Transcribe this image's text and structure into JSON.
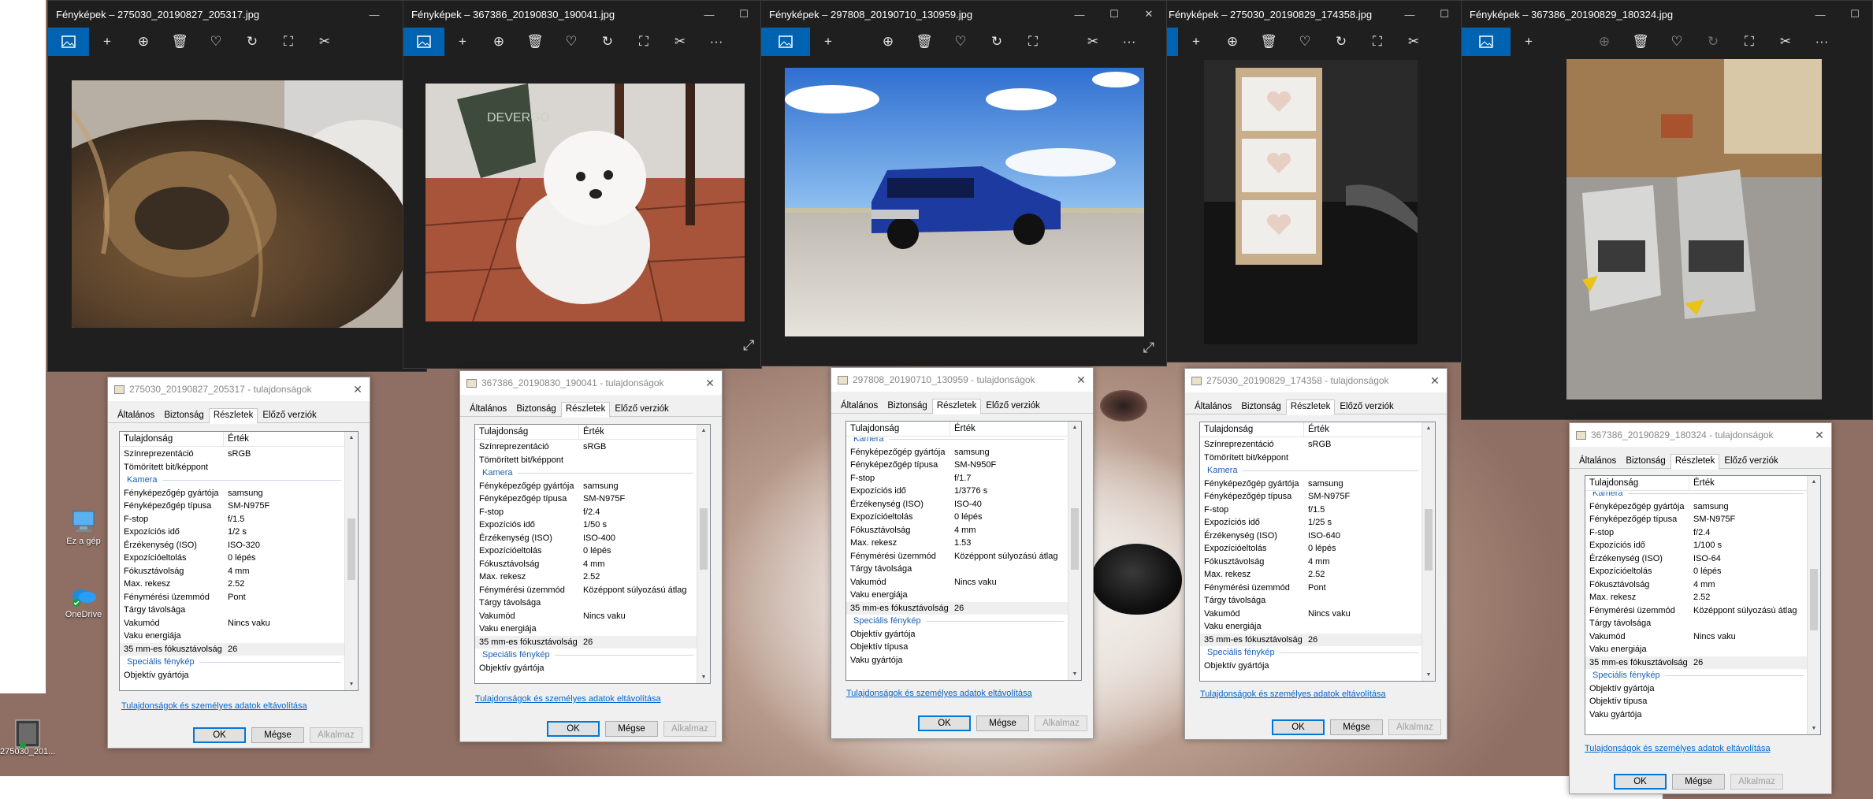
{
  "photos_app": {
    "windows": [
      {
        "title": "Fényképek – 275030_20190827_205317.jpg"
      },
      {
        "title": "Fényképek – 367386_20190830_190041.jpg"
      },
      {
        "title": "Fényképek – 297808_20190710_130959.jpg"
      },
      {
        "title": "Fényképek – 275030_20190829_174358.jpg"
      },
      {
        "title": "Fényképek – 367386_20190829_180324.jpg"
      }
    ],
    "window_controls": {
      "minimize": "—",
      "maximize": "☐",
      "close": "✕"
    },
    "toolbar_glyphs": {
      "add": "+",
      "zoom": "⊕",
      "delete": "🗑",
      "favorite": "♡",
      "rotate": "↻",
      "crop": "⛶",
      "edit": "✂",
      "more": "···",
      "expand": "⤢"
    },
    "bag_text": "DEVERGO"
  },
  "desktop": {
    "icons": [
      {
        "label": "Ez a gép",
        "icon": "computer-icon"
      },
      {
        "label": "OneDrive",
        "icon": "onedrive-icon"
      },
      {
        "label": "275030_201...",
        "icon": "image-file-icon"
      }
    ]
  },
  "dialog_common": {
    "title_suffix": " - tulajdonságok",
    "tabs": [
      "Általános",
      "Biztonság",
      "Részletek",
      "Előző verziók"
    ],
    "column_property": "Tulajdonság",
    "column_value": "Érték",
    "remove_link": "Tulajdonságok és személyes adatok eltávolítása",
    "ok": "OK",
    "cancel": "Mégse",
    "apply": "Alkalmaz",
    "close": "✕"
  },
  "dialogs": [
    {
      "filename": "275030_20190827_205317",
      "rows": [
        {
          "k": "Színreprezentáció",
          "v": "sRGB"
        },
        {
          "k": "Tömörített bit/képpont",
          "v": ""
        },
        {
          "k": "Kamera",
          "v": "",
          "section": true
        },
        {
          "k": "Fényképezőgép gyártója",
          "v": "samsung"
        },
        {
          "k": "Fényképezőgép típusa",
          "v": "SM-N975F"
        },
        {
          "k": "F-stop",
          "v": "f/1.5"
        },
        {
          "k": "Expozíciós idő",
          "v": "1/2 s"
        },
        {
          "k": "Érzékenység (ISO)",
          "v": "ISO-320"
        },
        {
          "k": "Expozícióeltolás",
          "v": "0 lépés"
        },
        {
          "k": "Fókusztávolság",
          "v": "4 mm"
        },
        {
          "k": "Max. rekesz",
          "v": "2.52"
        },
        {
          "k": "Fénymérési üzemmód",
          "v": "Pont"
        },
        {
          "k": "Tárgy távolsága",
          "v": ""
        },
        {
          "k": "Vakumód",
          "v": "Nincs vaku"
        },
        {
          "k": "Vaku energiája",
          "v": ""
        },
        {
          "k": "35 mm-es fókusztávolság",
          "v": "26",
          "selected": true
        },
        {
          "k": "Speciális fénykép",
          "v": "",
          "section": true
        },
        {
          "k": "Objektív gyártója",
          "v": ""
        }
      ]
    },
    {
      "filename": "367386_20190830_190041",
      "rows": [
        {
          "k": "Színreprezentáció",
          "v": "sRGB"
        },
        {
          "k": "Tömörített bit/képpont",
          "v": ""
        },
        {
          "k": "Kamera",
          "v": "",
          "section": true
        },
        {
          "k": "Fényképezőgép gyártója",
          "v": "samsung"
        },
        {
          "k": "Fényképezőgép típusa",
          "v": "SM-N975F"
        },
        {
          "k": "F-stop",
          "v": "f/2.4"
        },
        {
          "k": "Expozíciós idő",
          "v": "1/50 s"
        },
        {
          "k": "Érzékenység (ISO)",
          "v": "ISO-400"
        },
        {
          "k": "Expozícióeltolás",
          "v": "0 lépés"
        },
        {
          "k": "Fókusztávolság",
          "v": "4 mm"
        },
        {
          "k": "Max. rekesz",
          "v": "2.52"
        },
        {
          "k": "Fénymérési üzemmód",
          "v": "Középpont súlyozású átlag"
        },
        {
          "k": "Tárgy távolsága",
          "v": ""
        },
        {
          "k": "Vakumód",
          "v": "Nincs vaku"
        },
        {
          "k": "Vaku energiája",
          "v": ""
        },
        {
          "k": "35 mm-es fókusztávolság",
          "v": "26",
          "selected": true
        },
        {
          "k": "Speciális fénykép",
          "v": "",
          "section": true
        },
        {
          "k": "Objektív gyártója",
          "v": ""
        }
      ]
    },
    {
      "filename": "297808_20190710_130959",
      "rows": [
        {
          "k": "Kamera",
          "v": "",
          "section": true
        },
        {
          "k": "Fényképezőgép gyártója",
          "v": "samsung"
        },
        {
          "k": "Fényképezőgép típusa",
          "v": "SM-N950F"
        },
        {
          "k": "F-stop",
          "v": "f/1.7"
        },
        {
          "k": "Expozíciós idő",
          "v": "1/3776 s"
        },
        {
          "k": "Érzékenység (ISO)",
          "v": "ISO-40"
        },
        {
          "k": "Expozícióeltolás",
          "v": "0 lépés"
        },
        {
          "k": "Fókusztávolság",
          "v": "4 mm"
        },
        {
          "k": "Max. rekesz",
          "v": "1.53"
        },
        {
          "k": "Fénymérési üzemmód",
          "v": "Középpont súlyozású átlag"
        },
        {
          "k": "Tárgy távolsága",
          "v": ""
        },
        {
          "k": "Vakumód",
          "v": "Nincs vaku"
        },
        {
          "k": "Vaku energiája",
          "v": ""
        },
        {
          "k": "35 mm-es fókusztávolság",
          "v": "26",
          "selected": true
        },
        {
          "k": "Speciális fénykép",
          "v": "",
          "section": true
        },
        {
          "k": "Objektív gyártója",
          "v": ""
        },
        {
          "k": "Objektív típusa",
          "v": ""
        },
        {
          "k": "Vaku gyártója",
          "v": ""
        }
      ]
    },
    {
      "filename": "275030_20190829_174358",
      "rows": [
        {
          "k": "Színreprezentáció",
          "v": "sRGB"
        },
        {
          "k": "Tömörített bit/képpont",
          "v": ""
        },
        {
          "k": "Kamera",
          "v": "",
          "section": true
        },
        {
          "k": "Fényképezőgép gyártója",
          "v": "samsung"
        },
        {
          "k": "Fényképezőgép típusa",
          "v": "SM-N975F"
        },
        {
          "k": "F-stop",
          "v": "f/1.5"
        },
        {
          "k": "Expozíciós idő",
          "v": "1/25 s"
        },
        {
          "k": "Érzékenység (ISO)",
          "v": "ISO-640"
        },
        {
          "k": "Expozícióeltolás",
          "v": "0 lépés"
        },
        {
          "k": "Fókusztávolság",
          "v": "4 mm"
        },
        {
          "k": "Max. rekesz",
          "v": "2.52"
        },
        {
          "k": "Fénymérési üzemmód",
          "v": "Pont"
        },
        {
          "k": "Tárgy távolsága",
          "v": ""
        },
        {
          "k": "Vakumód",
          "v": "Nincs vaku"
        },
        {
          "k": "Vaku energiája",
          "v": ""
        },
        {
          "k": "35 mm-es fókusztávolság",
          "v": "26",
          "selected": true
        },
        {
          "k": "Speciális fénykép",
          "v": "",
          "section": true
        },
        {
          "k": "Objektív gyártója",
          "v": ""
        }
      ]
    },
    {
      "filename": "367386_20190829_180324",
      "rows": [
        {
          "k": "Kamera",
          "v": "",
          "section": true
        },
        {
          "k": "Fényképezőgép gyártója",
          "v": "samsung"
        },
        {
          "k": "Fényképezőgép típusa",
          "v": "SM-N975F"
        },
        {
          "k": "F-stop",
          "v": "f/2.4"
        },
        {
          "k": "Expozíciós idő",
          "v": "1/100 s"
        },
        {
          "k": "Érzékenység (ISO)",
          "v": "ISO-64"
        },
        {
          "k": "Expozícióeltolás",
          "v": "0 lépés"
        },
        {
          "k": "Fókusztávolság",
          "v": "4 mm"
        },
        {
          "k": "Max. rekesz",
          "v": "2.52"
        },
        {
          "k": "Fénymérési üzemmód",
          "v": "Középpont súlyozású átlag"
        },
        {
          "k": "Tárgy távolsága",
          "v": ""
        },
        {
          "k": "Vakumód",
          "v": "Nincs vaku"
        },
        {
          "k": "Vaku energiája",
          "v": ""
        },
        {
          "k": "35 mm-es fókusztávolság",
          "v": "26",
          "selected": true
        },
        {
          "k": "Speciális fénykép",
          "v": "",
          "section": true
        },
        {
          "k": "Objektív gyártója",
          "v": ""
        },
        {
          "k": "Objektív típusa",
          "v": ""
        },
        {
          "k": "Vaku gyártója",
          "v": ""
        }
      ]
    }
  ]
}
